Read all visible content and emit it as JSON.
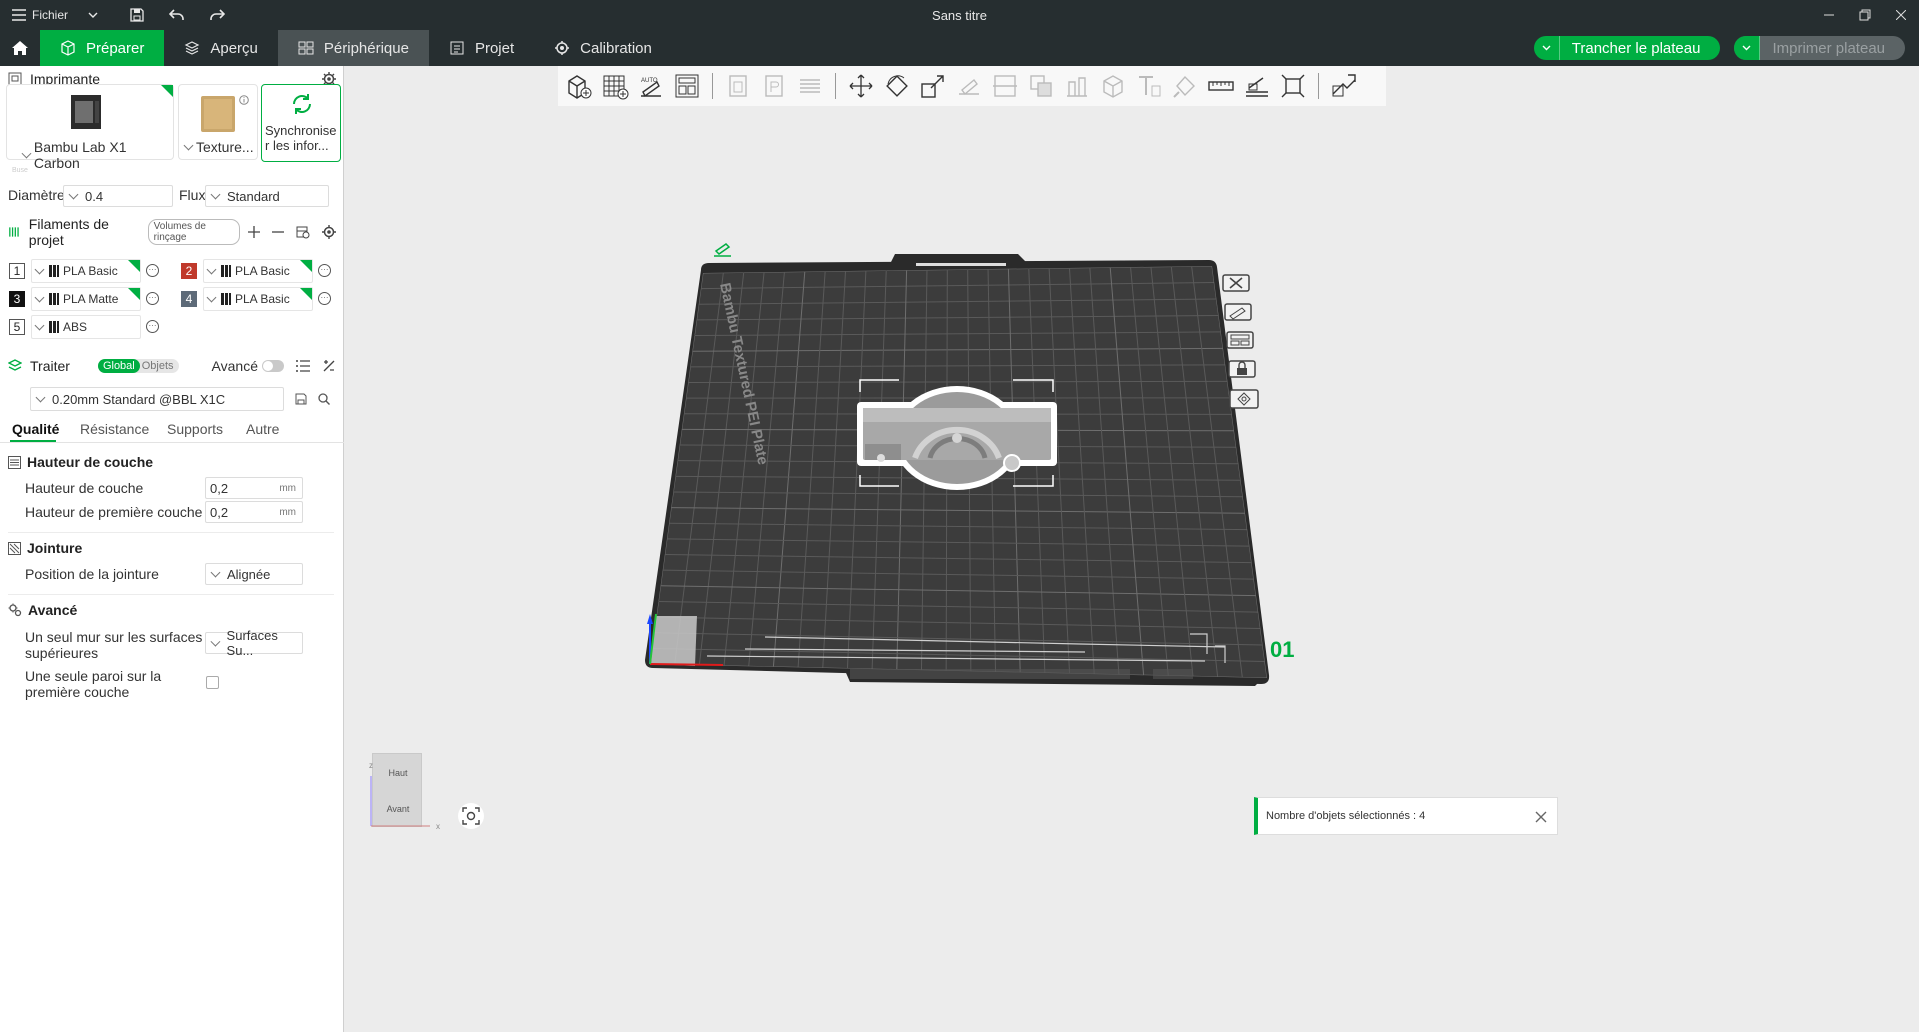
{
  "window": {
    "menu_label": "Fichier",
    "title": "Sans titre"
  },
  "tabs": [
    {
      "label": "Préparer",
      "icon": "cube-icon"
    },
    {
      "label": "Aperçu",
      "icon": "layers-icon"
    },
    {
      "label": "Périphérique",
      "icon": "device-icon"
    },
    {
      "label": "Projet",
      "icon": "document-icon"
    },
    {
      "label": "Calibration",
      "icon": "calibration-icon"
    }
  ],
  "actions": {
    "slice_label": "Trancher le plateau",
    "print_label": "Imprimer plateau"
  },
  "printer": {
    "section_title": "Imprimante",
    "printer_name": "Bambu Lab X1 Carbon",
    "plate_name": "Texture...",
    "sync_label_1": "Synchronise",
    "sync_label_2": "r les infor...",
    "faded_label": "Buse",
    "diameter_label": "Diamètre",
    "diameter_value": "0.4",
    "flow_label": "Flux",
    "flow_value": "Standard"
  },
  "filaments": {
    "section_title": "Filaments de projet",
    "flush_label": "Volumes de rinçage",
    "items": [
      {
        "num": "1",
        "name": "PLA Basic",
        "color": "#ffffff"
      },
      {
        "num": "2",
        "name": "PLA Basic",
        "color": "#c0392b"
      },
      {
        "num": "3",
        "name": "PLA Matte",
        "color": "#111111"
      },
      {
        "num": "4",
        "name": "PLA Basic",
        "color": "#5d6a78"
      },
      {
        "num": "5",
        "name": "ABS",
        "color": "#ffffff"
      }
    ]
  },
  "process": {
    "section_title": "Traiter",
    "global_label": "Global",
    "objects_label": "Objets",
    "advanced_label": "Avancé",
    "profile": "0.20mm Standard @BBL X1C",
    "subtabs": [
      "Qualité",
      "Résistance",
      "Supports",
      "Autre"
    ]
  },
  "quality": {
    "layer_section": "Hauteur de couche",
    "layer_height_label": "Hauteur de couche",
    "layer_height_value": "0,2",
    "first_layer_label": "Hauteur de première couche",
    "first_layer_value": "0,2",
    "unit": "mm",
    "seam_section": "Jointure",
    "seam_position_label": "Position de la jointure",
    "seam_position_value": "Alignée",
    "advanced_section": "Avancé",
    "top_wall_label_1": "Un seul mur sur les surfaces",
    "top_wall_label_2": "supérieures",
    "top_wall_value": "Surfaces Su...",
    "first_wall_label_1": "Une seule paroi sur la",
    "first_wall_label_2": "première couche"
  },
  "viewport": {
    "plate_text": "Bambu Textured PEI Plate",
    "plate_number": "01",
    "status_text": "Nombre d'objets sélectionnés : 4",
    "viewcube_top": "Haut",
    "viewcube_front": "Avant",
    "axis_x": "x",
    "axis_z": "z"
  },
  "colors": {
    "accent": "#00ae42",
    "topbar": "#262e30",
    "plate": "#3c3c3c"
  }
}
